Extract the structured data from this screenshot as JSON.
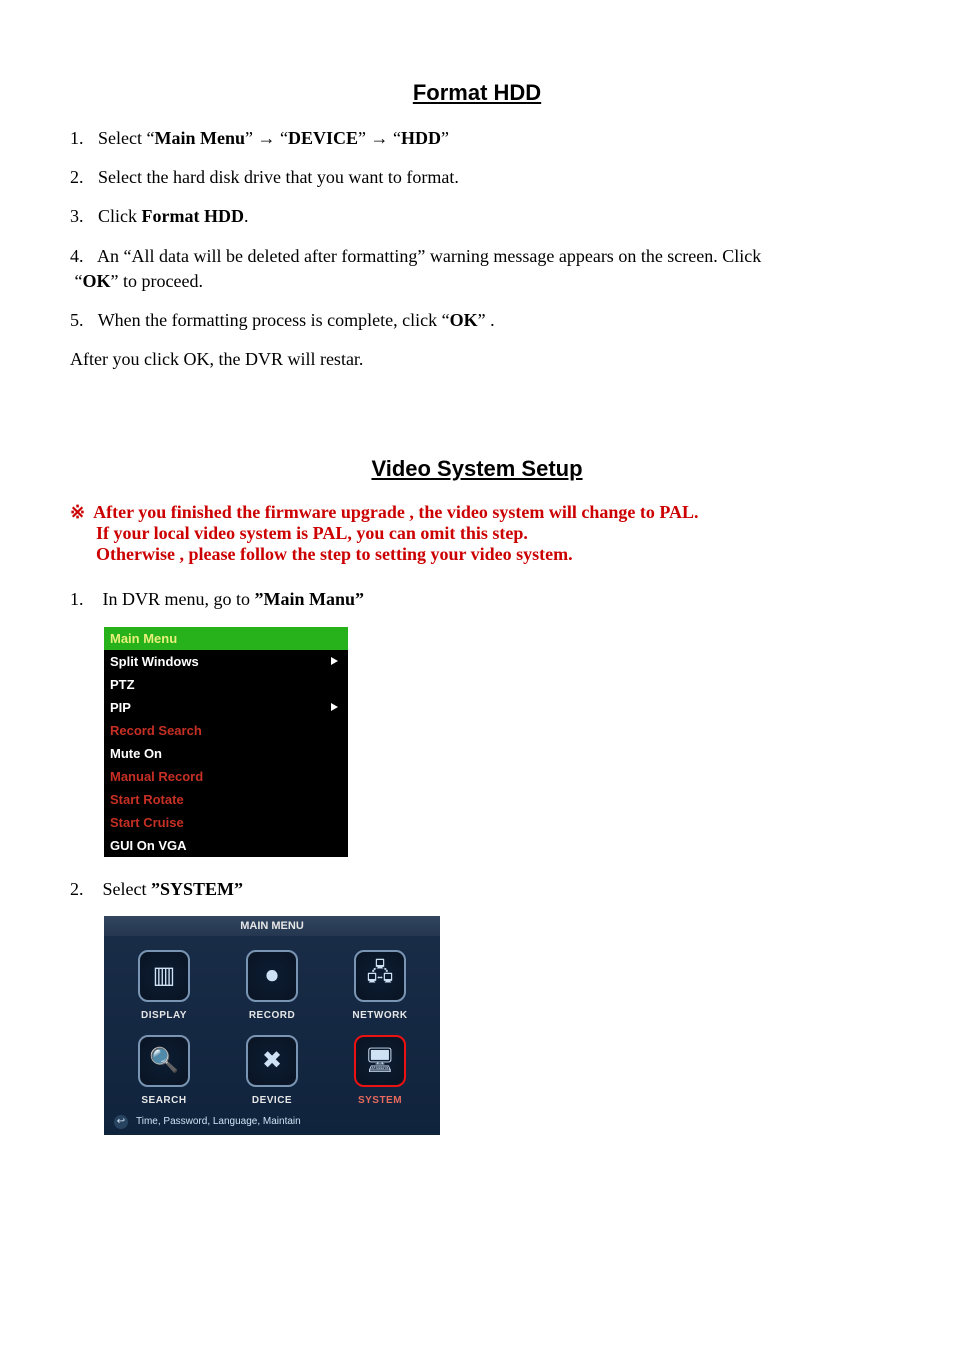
{
  "section1": {
    "title": "Format HDD",
    "step1": {
      "num": "1.",
      "prefix": "Select  “",
      "b1": "Main Menu",
      "sep": "”  →   “",
      "b2": "DEVICE",
      "sep2": "”  →   “",
      "b3": "HDD",
      "suffix": "”"
    },
    "step2": {
      "num": "2.",
      "text": "Select the hard disk drive that you want to format."
    },
    "step3": {
      "num": "3.",
      "prefix": "Click ",
      "b": "Format HDD",
      "suffix": "."
    },
    "step4": {
      "num": "4.",
      "line1": "An “All data will be deleted after formatting” warning message appears on the screen. Click",
      "line2a": "“",
      "ok": "OK",
      "line2b": "”   to proceed."
    },
    "step5": {
      "num": "5.",
      "prefix": "When the formatting process is complete, click   “",
      "ok": "OK",
      "suffix": "” ."
    },
    "after": "After you click OK, the DVR will restar."
  },
  "section2": {
    "title": "Video System Setup",
    "mark": "※",
    "warn1": "After you finished the firmware upgrade , the video system will change to PAL.",
    "warn2": "If your local video system is PAL, you can omit this step.",
    "warn3": "Otherwise , please follow the step to setting your video system.",
    "step1": {
      "num": "1.",
      "prefix": "In DVR menu, go to ",
      "b": "”Main Manu”"
    },
    "step2": {
      "num": "2.",
      "prefix": "Select ",
      "b": "”SYSTEM”"
    }
  },
  "dvr_menu": {
    "header": "Main  Menu",
    "items": [
      {
        "label": "Split  Windows",
        "arrow": true,
        "red": false
      },
      {
        "label": "PTZ",
        "arrow": false,
        "red": false
      },
      {
        "label": "PIP",
        "arrow": true,
        "red": false
      },
      {
        "label": "Record  Search",
        "arrow": false,
        "red": true
      },
      {
        "label": "Mute  On",
        "arrow": false,
        "red": false
      },
      {
        "label": "Manual  Record",
        "arrow": false,
        "red": true
      },
      {
        "label": "Start  Rotate",
        "arrow": false,
        "red": true
      },
      {
        "label": "Start  Cruise",
        "arrow": false,
        "red": true
      },
      {
        "label": "GUI  On  VGA",
        "arrow": false,
        "red": false
      }
    ]
  },
  "tile_menu": {
    "title": "MAIN  MENU",
    "tiles": [
      {
        "label": "DISPLAY",
        "glyph": "▥",
        "selected": false
      },
      {
        "label": "RECORD",
        "glyph": "⏺",
        "selected": false
      },
      {
        "label": "NETWORK",
        "glyph": "🖧",
        "selected": false
      },
      {
        "label": "SEARCH",
        "glyph": "🔍",
        "selected": false
      },
      {
        "label": "DEVICE",
        "glyph": "✖",
        "selected": false
      },
      {
        "label": "SYSTEM",
        "glyph": "🖥",
        "selected": true
      }
    ],
    "footer": "Time, Password, Language, Maintain"
  }
}
